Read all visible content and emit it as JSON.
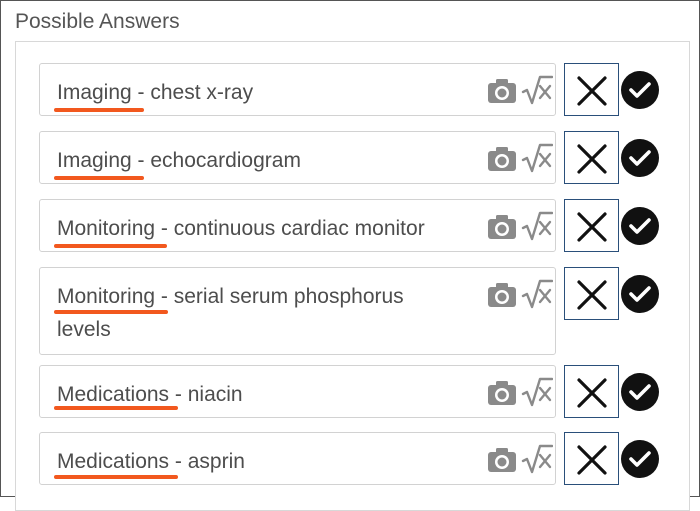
{
  "section": {
    "title": "Possible Answers"
  },
  "answers": [
    {
      "category": "Imaging",
      "detail": " - chest x-ray",
      "line2": ""
    },
    {
      "category": "Imaging",
      "detail": " - echocardiogram",
      "line2": ""
    },
    {
      "category": "Monitoring",
      "detail": " - continuous cardiac monitor",
      "line2": ""
    },
    {
      "category": "Monitoring",
      "detail": " - serial serum phosphorus",
      "line2": "levels"
    },
    {
      "category": "Medications",
      "detail": " - niacin",
      "line2": ""
    },
    {
      "category": "Medications",
      "detail": " - asprin",
      "line2": ""
    }
  ],
  "icons": {
    "camera": "camera-icon",
    "math": "square-root-x-icon",
    "remove": "close-icon",
    "correct": "checkmark-icon"
  },
  "colors": {
    "underline": "#f2581e",
    "remove_border": "#2a4f7a",
    "icon_gray": "#8a8a8a"
  }
}
